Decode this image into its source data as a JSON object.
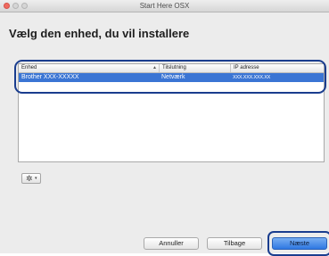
{
  "window": {
    "title": "Start Here OSX"
  },
  "heading": "Vælg den enhed, du vil installere",
  "table": {
    "columns": [
      "Enhed",
      "Tilslutning",
      "IP adresse"
    ],
    "rows": [
      {
        "device": "Brother XXX-XXXXX",
        "connection": "Netværk",
        "ip": "XXX.XXX.XXX.XX",
        "selected": true
      }
    ]
  },
  "gear_menu": {
    "icon": "gear-icon",
    "caret": "▾"
  },
  "buttons": {
    "cancel": "Annuller",
    "back": "Tilbage",
    "next": "Næste"
  },
  "colors": {
    "selection": "#3b75d4",
    "highlight_outline": "#1a3d8e",
    "default_button": "#2e78e2"
  }
}
